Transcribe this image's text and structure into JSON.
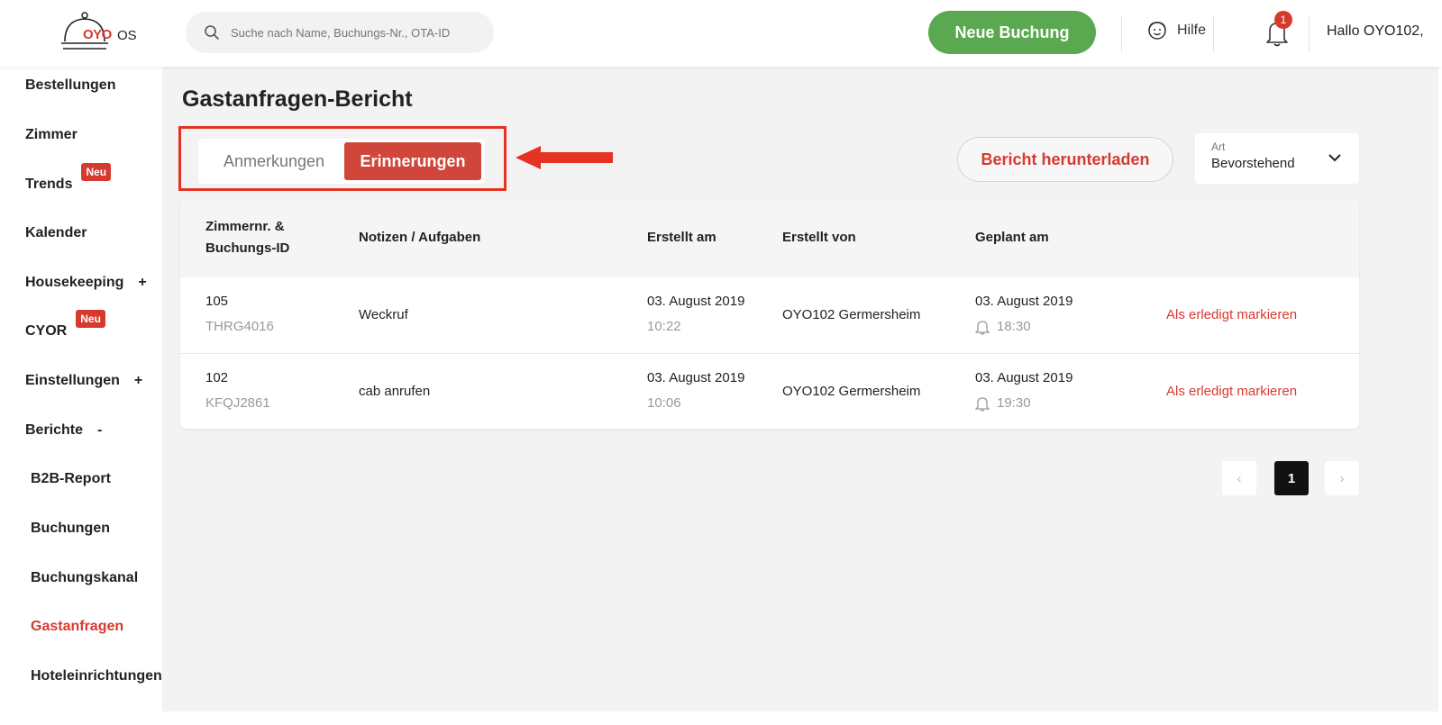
{
  "header": {
    "logo_text": "OYO",
    "logo_suffix": "OS",
    "search_placeholder": "Suche nach Name, Buchungs-Nr., OTA-ID",
    "new_booking_label": "Neue Buchung",
    "help_label": "Hilfe",
    "notification_count": "1",
    "greeting": "Hallo OYO102,"
  },
  "sidebar": {
    "items": [
      {
        "label": "Bestellungen"
      },
      {
        "label": "Zimmer"
      },
      {
        "label": "Trends",
        "badge": "Neu"
      },
      {
        "label": "Kalender"
      },
      {
        "label": "Housekeeping",
        "toggle": "+"
      },
      {
        "label": "CYOR",
        "badge": "Neu"
      },
      {
        "label": "Einstellungen",
        "toggle": "+"
      },
      {
        "label": "Berichte",
        "toggle": "-"
      },
      {
        "label": "B2B-Report"
      },
      {
        "label": "Buchungen"
      },
      {
        "label": "Buchungskanal"
      },
      {
        "label": "Gastanfragen"
      },
      {
        "label": "Hoteleinrichtungen"
      }
    ]
  },
  "main": {
    "title": "Gastanfragen-Bericht",
    "tabs": [
      {
        "label": "Anmerkungen"
      },
      {
        "label": "Erinnerungen"
      }
    ],
    "download_label": "Bericht herunterladen",
    "filter": {
      "label": "Art",
      "value": "Bevorstehend"
    }
  },
  "table": {
    "headers": [
      "Zimmernr. &",
      "Buchungs-ID",
      "Notizen / Aufgaben",
      "Erstellt am",
      "Erstellt von",
      "Geplant am"
    ],
    "rows": [
      {
        "room": "105",
        "booking_id": "THRG4016",
        "note": "Weckruf",
        "created_date": "03. August 2019",
        "created_time": "10:22",
        "created_by": "OYO102 Germersheim",
        "planned_date": "03. August 2019",
        "planned_time": "18:30",
        "action": "Als erledigt markieren"
      },
      {
        "room": "102",
        "booking_id": "KFQJ2861",
        "note": "cab anrufen",
        "created_date": "03. August 2019",
        "created_time": "10:06",
        "created_by": "OYO102 Germersheim",
        "planned_date": "03. August 2019",
        "planned_time": "19:30",
        "action": "Als erledigt markieren"
      }
    ]
  },
  "pagination": {
    "current_page": "1",
    "prev_label": "‹",
    "next_label": "›"
  },
  "colors": {
    "accent": "#d63a2f",
    "primary_green": "#5aa84f",
    "highlight_frame": "#e53224"
  }
}
